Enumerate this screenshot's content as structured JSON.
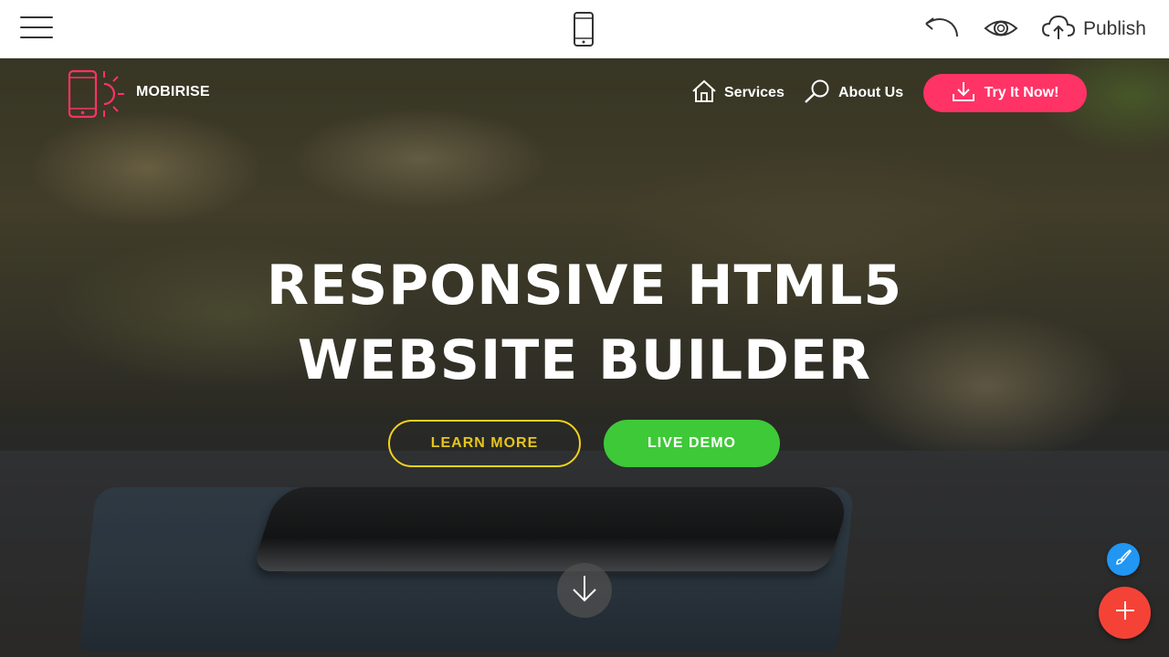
{
  "toolbar": {
    "menu_icon": "hamburger-menu-icon",
    "device_icon": "mobile-phone-icon",
    "undo_icon": "undo-icon",
    "preview_icon": "eye-icon",
    "publish_icon": "cloud-upload-icon",
    "publish_label": "Publish"
  },
  "site": {
    "brand": "MOBIRISE",
    "logo_icon": "phone-sun-logo-icon",
    "nav": [
      {
        "label": "Services",
        "icon": "home-icon"
      },
      {
        "label": "About Us",
        "icon": "search-icon"
      }
    ],
    "cta_label": "Try It Now!",
    "cta_icon": "download-icon"
  },
  "hero": {
    "title_line1": "RESPONSIVE HTML5",
    "title_line2": "WEBSITE BUILDER",
    "learn_more": "LEARN MORE",
    "live_demo": "LIVE DEMO",
    "scroll_icon": "arrow-down-icon"
  },
  "fab": {
    "edit_icon": "paint-brush-icon",
    "add_icon": "plus-icon"
  },
  "colors": {
    "accent_pink": "#ff3366",
    "learn_yellow": "#f1d21c",
    "demo_green": "#3ec938",
    "fab_blue": "#2196f3",
    "fab_red": "#f44336"
  }
}
